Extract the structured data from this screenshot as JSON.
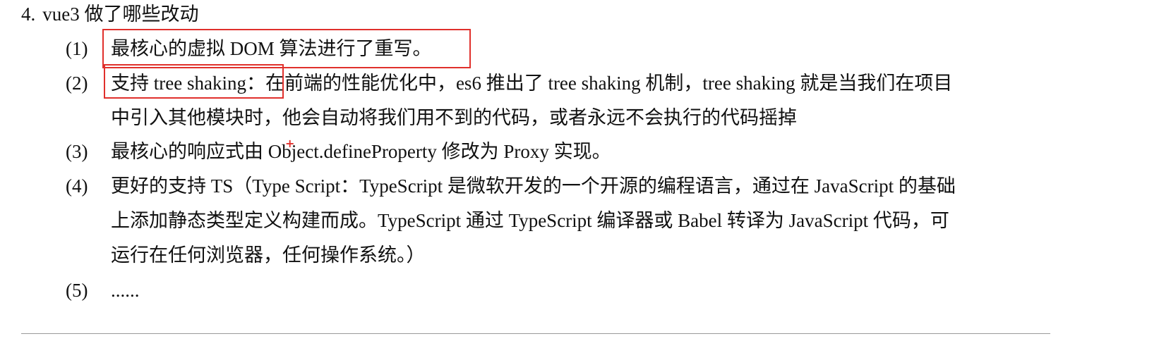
{
  "heading": {
    "number": "4.",
    "text": "vue3 做了哪些改动"
  },
  "items": [
    {
      "marker": "(1)",
      "lines": [
        "最核心的虚拟 DOM 算法进行了重写。"
      ]
    },
    {
      "marker": "(2)",
      "lead": "支持 tree shaking：",
      "lines": [
        "在前端的性能优化中，es6 推出了 tree shaking 机制，tree shaking 就是当我们在项目",
        "中引入其他模块时，他会自动将我们用不到的代码，或者永远不会执行的代码摇掉"
      ]
    },
    {
      "marker": "(3)",
      "lines": [
        "最核心的响应式由 Object.defineProperty 修改为 Proxy 实现。"
      ]
    },
    {
      "marker": "(4)",
      "lines": [
        "更好的支持 TS（Type Script：TypeScript 是微软开发的一个开源的编程语言，通过在 JavaScript 的基础",
        "上添加静态类型定义构建而成。TypeScript 通过 TypeScript 编译器或 Babel 转译为 JavaScript 代码，可",
        "运行在任何浏览器，任何操作系统。）"
      ]
    },
    {
      "marker": "(5)",
      "lines": [
        "......"
      ]
    }
  ],
  "annotations": {
    "highlight_color": "#e0302c",
    "cursor_glyph": "+"
  }
}
